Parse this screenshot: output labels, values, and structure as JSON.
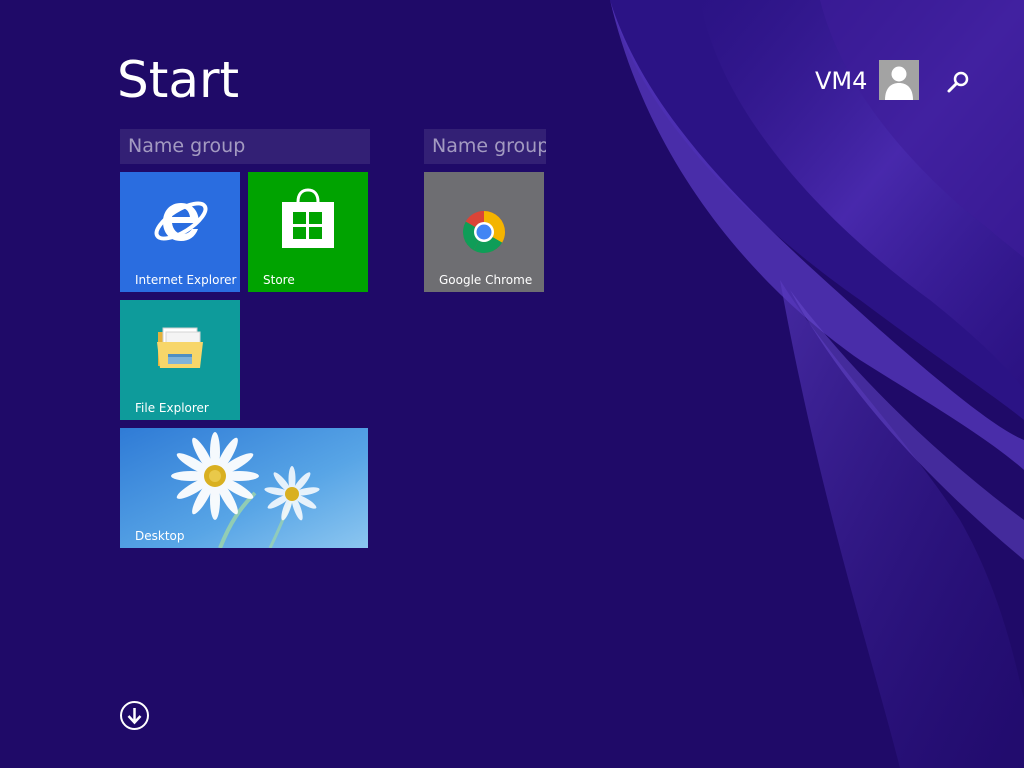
{
  "start": {
    "title": "Start"
  },
  "user": {
    "name": "VM4"
  },
  "groups": [
    {
      "label": "Name group"
    },
    {
      "label": "Name group"
    }
  ],
  "tiles": {
    "ie": {
      "label": "Internet Explorer",
      "color": "#2a6de0",
      "icon": "internet-explorer-icon"
    },
    "store": {
      "label": "Store",
      "color": "#00a300",
      "icon": "store-icon"
    },
    "file_explorer": {
      "label": "File Explorer",
      "color": "#0e9b9b",
      "icon": "folder-icon"
    },
    "desktop": {
      "label": "Desktop",
      "color": "#3a8bd8",
      "icon": "daisy-wallpaper"
    },
    "chrome": {
      "label": "Google Chrome",
      "color": "#6e6e72",
      "icon": "chrome-icon"
    }
  },
  "icons": {
    "search": "search-icon",
    "apps": "down-arrow-icon",
    "avatar": "user-avatar-icon"
  },
  "colors": {
    "background": "#1f0a68",
    "swirl": "#4a2aa8"
  }
}
